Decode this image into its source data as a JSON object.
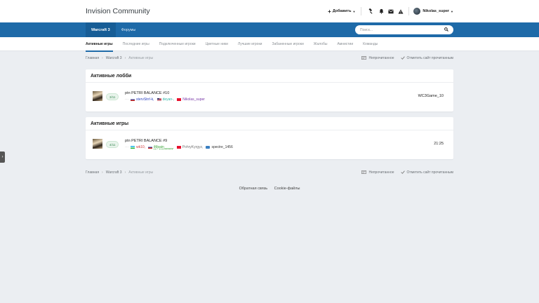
{
  "header": {
    "brand": "Invision Community",
    "create_label": "Добавить",
    "username": "Nikolas_super"
  },
  "nav": {
    "tabs": [
      {
        "label": "Warcraft 3",
        "active": true
      },
      {
        "label": "Форумы",
        "active": false
      }
    ],
    "search_placeholder": "Поиск..."
  },
  "subnav": {
    "items": [
      {
        "label": "Активные игры",
        "active": true
      },
      {
        "label": "Последние игры",
        "active": false
      },
      {
        "label": "Подключенные игроки",
        "active": false
      },
      {
        "label": "Цветные ники",
        "active": false
      },
      {
        "label": "Лучшие игроки",
        "active": false
      },
      {
        "label": "Забаненные игроки",
        "active": false
      },
      {
        "label": "Жалобы",
        "active": false
      },
      {
        "label": "Амнистии",
        "active": false
      },
      {
        "label": "Команды",
        "active": false
      }
    ]
  },
  "breadcrumb": {
    "items": [
      "Главная",
      "Warcraft 3"
    ],
    "current": "Активные игры",
    "unread": "Непрочитанное",
    "mark_read": "Отметить сайт прочитанным"
  },
  "lobbies": {
    "title": "Активные лобби",
    "rows": [
      {
        "slots": "3/11",
        "name": "ptn PETRI BALANCE #10",
        "players": [
          {
            "flag": "ru",
            "name": "stervStrrl-k,",
            "color": "blue"
          },
          {
            "flag": "us",
            "name": "deyan-,",
            "color": "teal"
          },
          {
            "flag": "kg",
            "name": "Nikolas_super",
            "color": "purple"
          }
        ],
        "right": "WC3Game_10"
      }
    ]
  },
  "games": {
    "title": "Активные игры",
    "rows": [
      {
        "slots": "4/11",
        "name": "ptn PETRI BALANCE #9",
        "players": [
          {
            "flag": "uz",
            "name": "wk10,",
            "color": "red"
          },
          {
            "flag": "ru",
            "name": "iMpain_____",
            "color": "green"
          },
          {
            "flag": "kg",
            "name": "PohryKyrgyz,",
            "color": "gray"
          },
          {
            "flag": "wd",
            "name": "spectre_1456",
            "color": "dark"
          }
        ],
        "right": "21:25"
      }
    ]
  },
  "footer": {
    "links": [
      "Обратная связь",
      "Cookie-файлы"
    ]
  },
  "colors": {
    "brand_blue": "#1e6aa8",
    "background": "#ebeef2"
  }
}
